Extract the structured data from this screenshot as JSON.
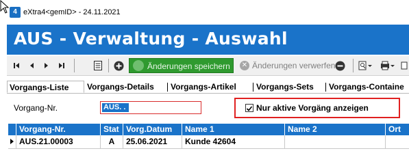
{
  "window": {
    "title": "eXtra4<gemID> - 24.11.2021"
  },
  "header": {
    "title": "AUS - Verwaltung - Auswahl"
  },
  "toolbar": {
    "save_label": "Änderungen speichern",
    "discard_label": "Änderungen verwerfen"
  },
  "tabs": [
    {
      "label": "Vorgangs-Liste"
    },
    {
      "label": "Vorgangs-Details"
    },
    {
      "label": "Vorgangs-Artikel"
    },
    {
      "label": "Vorgangs-Sets"
    },
    {
      "label": "Vorgangs-Containe"
    }
  ],
  "filter": {
    "vorgang_label": "Vorgang-Nr.",
    "vorgang_value": "AUS. . ",
    "only_active_label": "Nur aktive Vorgäng anzeigen",
    "only_active_checked": true
  },
  "table": {
    "columns": [
      "Vorgang-Nr.",
      "Stat",
      "Vorg.Datum",
      "Name 1",
      "Name 2",
      "Ort"
    ],
    "rows": [
      [
        "AUS.21.00003",
        "A",
        "25.06.2021",
        "Kunde 42604",
        "",
        ""
      ]
    ]
  },
  "colors": {
    "accent": "#1a73c9",
    "save_green": "#2f9a2f",
    "highlight_red": "#e02020"
  }
}
